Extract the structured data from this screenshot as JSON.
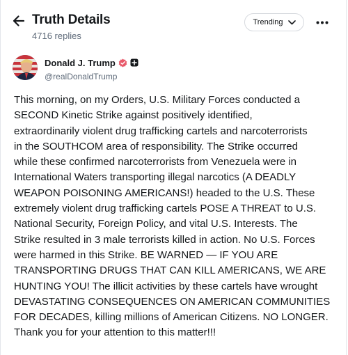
{
  "header": {
    "title": "Truth Details",
    "reply_count": "4716 replies",
    "sort_label": "Trending",
    "back_icon": "arrow-left-icon",
    "more_icon": "ellipsis-horizontal-icon",
    "sort_icon": "chevron-down-icon"
  },
  "post": {
    "author": {
      "display_name": "Donald J. Trump",
      "handle": "@realDonaldTrump",
      "verified_icon": "verified-badge-icon",
      "verified_color": "#e8596a",
      "extra_badge_icon": "plus-badge-icon"
    },
    "body": "This morning, on my Orders, U.S. Military Forces conducted a\nSECOND Kinetic Strike against positively identified,\nextraordinarily violent drug trafficking cartels and narcoterrorists\nin the SOUTHCOM area of responsibility. The Strike occurred\nwhile these confirmed narcoterrorists from Venezuela were in\nInternational Waters transporting illegal narcotics (A DEADLY\nWEAPON POISONING AMERICANS!) headed to the U.S. These\nextremely violent drug trafficking cartels POSE A THREAT to U.S.\nNational Security, Foreign Policy, and vital U.S. Interests. The\nStrike resulted in 3 male terrorists killed in action. No U.S. Forces\nwere harmed in this Strike. BE WARNED — IF YOU ARE\nTRANSPORTING DRUGS THAT CAN KILL AMERICANS, WE ARE\nHUNTING YOU! The illicit activities by these cartels have wrought\nDEVASTATING CONSEQUENCES ON AMERICAN COMMUNITIES\nFOR DECADES, killing millions of American Citizens. NO LONGER.\nThank you for your attention to this matter!!!"
  }
}
